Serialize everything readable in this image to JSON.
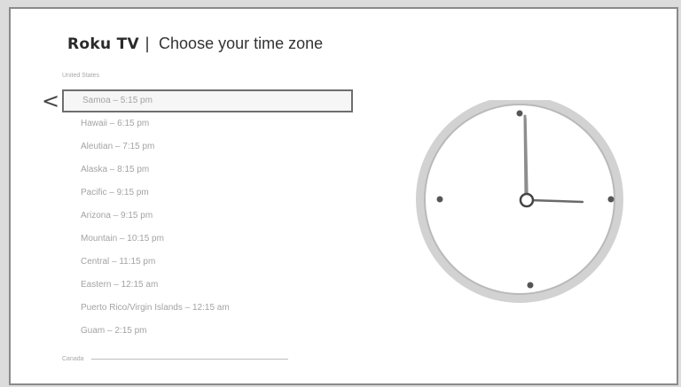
{
  "header": {
    "brand": "Roku TV",
    "divider": "|",
    "title": "Choose your time zone"
  },
  "back_icon": "<",
  "sections": {
    "united_states": "United States",
    "canada": "Canada"
  },
  "timezones": [
    "Samoa – 5:15 pm",
    "Hawaii – 6:15 pm",
    "Aleutian – 7:15 pm",
    "Alaska – 8:15 pm",
    "Pacific – 9:15 pm",
    "Arizona – 9:15 pm",
    "Mountain – 10:15 pm",
    "Central – 11:15 pm",
    "Eastern – 12:15 am",
    "Puerto Rico/Virgin Islands – 12:15 am",
    "Guam – 2:15 pm"
  ],
  "selected_index": 0,
  "clock": {
    "icon": "analog-clock-icon",
    "hour": 3,
    "minute": 0,
    "face_color": "#ffffff",
    "rim_color": "#c8c8c8"
  }
}
